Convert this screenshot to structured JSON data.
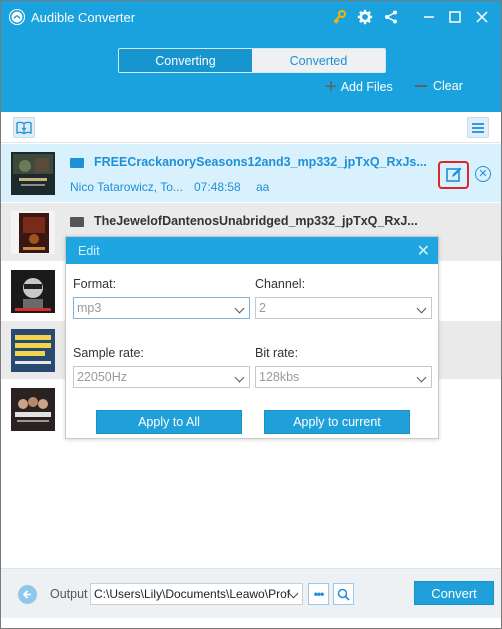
{
  "app": {
    "title": "Audible Converter"
  },
  "tabs": [
    {
      "label": "Converting",
      "active": true
    },
    {
      "label": "Converted",
      "active": false
    }
  ],
  "actions": {
    "add_files": "Add Files",
    "clear": "Clear"
  },
  "files": [
    {
      "name": "FREECrackanorySeasons12and3_mp332_jpTxQ_RxJs...",
      "author": "Nico Tatarowicz, To...",
      "duration": "07:48:58",
      "extra": "aa",
      "selected": true
    },
    {
      "name": "TheJewelofDantenosUnabridged_mp332_jpTxQ_RxJ...",
      "selected": false
    }
  ],
  "edit_dialog": {
    "title": "Edit",
    "format": {
      "label": "Format:",
      "value": "mp3"
    },
    "channel": {
      "label": "Channel:",
      "value": "2"
    },
    "sample_rate": {
      "label": "Sample rate:",
      "value": "22050Hz"
    },
    "bit_rate": {
      "label": "Bit rate:",
      "value": "128kbs"
    },
    "apply_all": "Apply to All",
    "apply_current": "Apply to current"
  },
  "output": {
    "label": "Output",
    "path": "C:\\Users\\Lily\\Documents\\Leawo\\Prof",
    "more": "•••"
  },
  "convert_label": "Convert",
  "colors": {
    "accent": "#19a2dd",
    "selected_row": "#d9f1fc",
    "edit_highlight": "#e0242c"
  }
}
